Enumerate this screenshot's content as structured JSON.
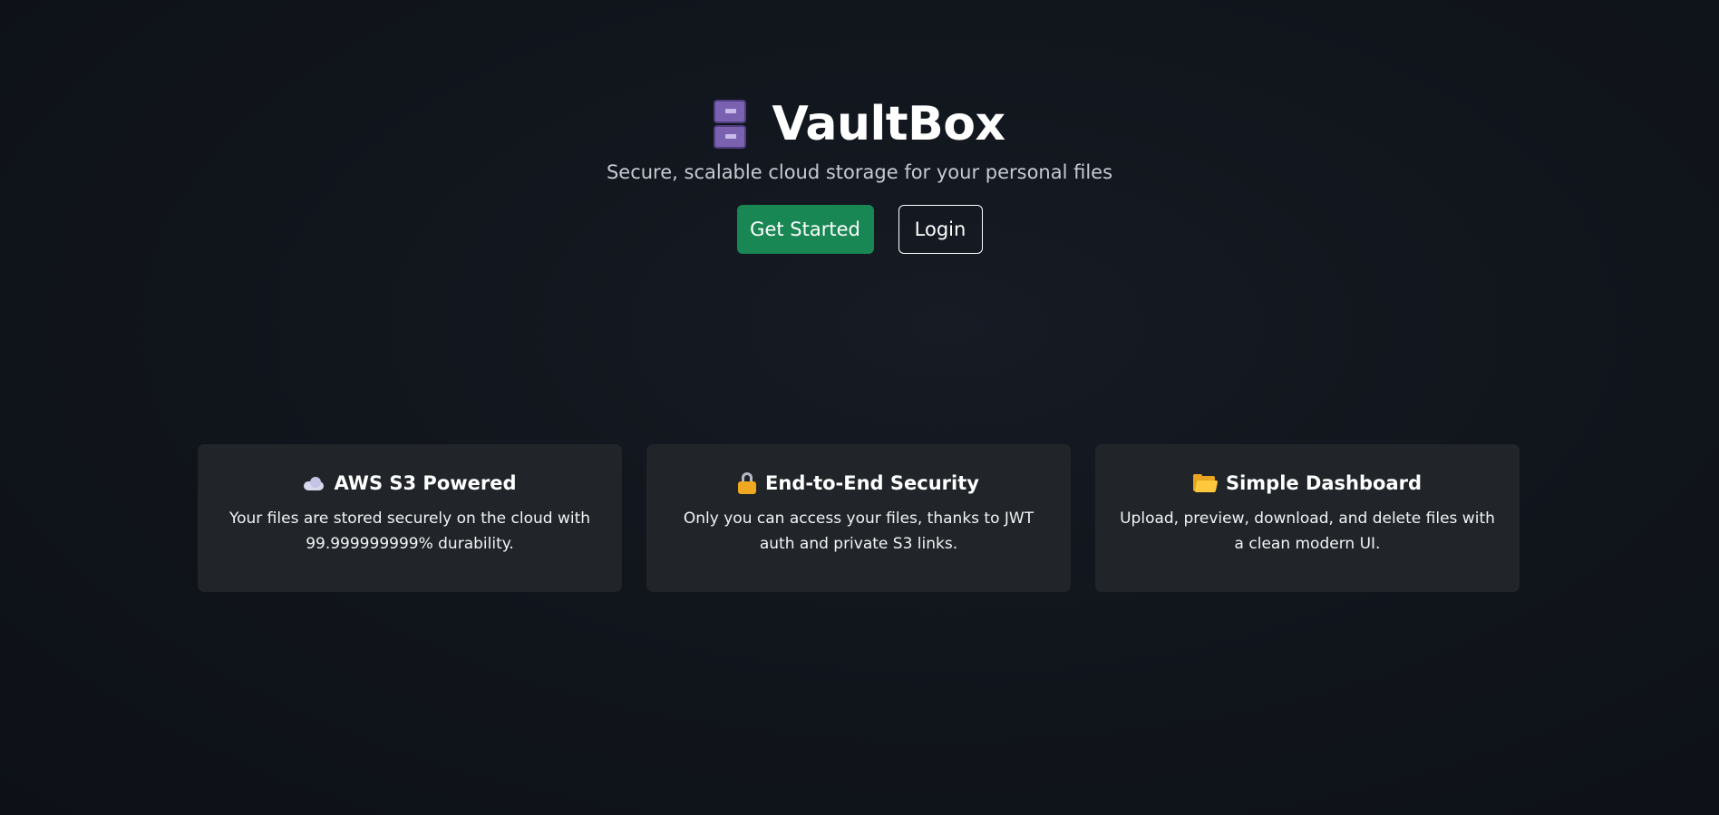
{
  "app": {
    "title": "VaultBox",
    "logo_icon": "file-cabinet-icon",
    "subtitle": "Secure, scalable cloud storage for your personal files"
  },
  "actions": {
    "get_started_label": "Get Started",
    "login_label": "Login"
  },
  "features": [
    {
      "icon": "cloud-icon",
      "title": "AWS S3 Powered",
      "description": "Your files are stored securely on the cloud with 99.999999999% durability."
    },
    {
      "icon": "lock-icon",
      "title": "End-to-End Security",
      "description": "Only you can access your files, thanks to JWT auth and private S3 links."
    },
    {
      "icon": "folder-icon",
      "title": "Simple Dashboard",
      "description": "Upload, preview, download, and delete files with a clean modern UI."
    }
  ],
  "colors": {
    "background": "#0d1117",
    "primary_button": "#198754",
    "card_background": "#212529",
    "text": "#ffffff",
    "subtitle_text": "#c6cbd3"
  }
}
